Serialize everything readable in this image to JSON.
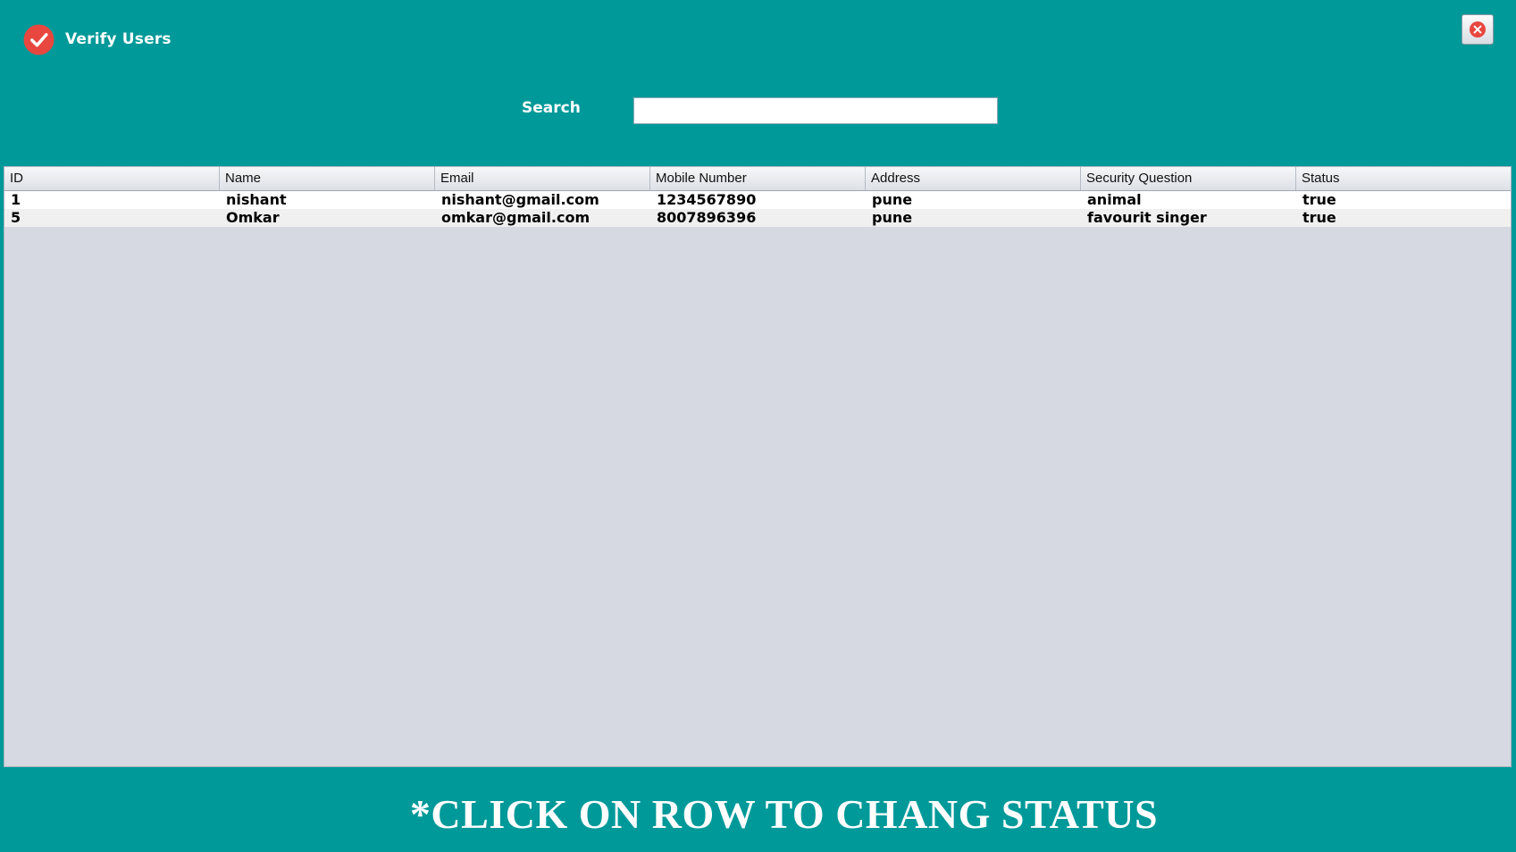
{
  "window": {
    "title": "Verify Users",
    "icon": "check-circle-icon",
    "close_icon": "close-icon",
    "accent_color": "#009999",
    "icon_color": "#e8473f"
  },
  "search": {
    "label": "Search",
    "value": "",
    "placeholder": ""
  },
  "table": {
    "columns": [
      "ID",
      "Name",
      "Email",
      "Mobile Number",
      "Address",
      "Security Question",
      "Status"
    ],
    "rows": [
      [
        "1",
        "nishant",
        "nishant@gmail.com",
        "1234567890",
        "pune",
        "animal",
        "true"
      ],
      [
        "5",
        "Omkar",
        "omkar@gmail.com",
        "8007896396",
        "pune",
        "favourit singer",
        "true"
      ]
    ]
  },
  "footer": {
    "instruction": "*CLICK ON ROW TO CHANG STATUS"
  }
}
